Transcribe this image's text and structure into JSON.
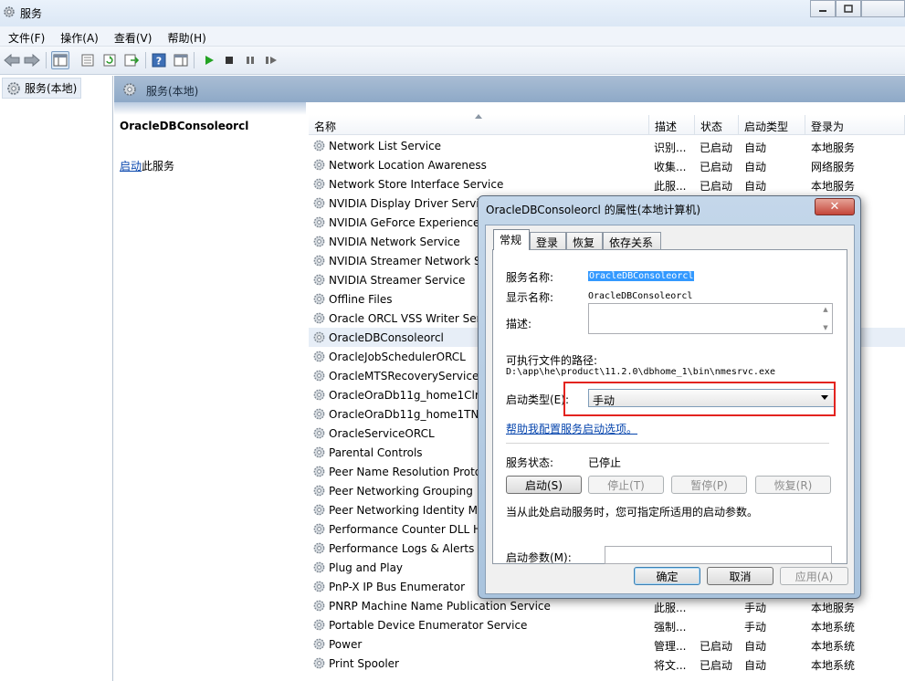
{
  "window": {
    "title": "服务"
  },
  "menu": [
    "文件(F)",
    "操作(A)",
    "查看(V)",
    "帮助(H)"
  ],
  "tree": {
    "root": "服务(本地)"
  },
  "header": {
    "title": "服务(本地)"
  },
  "extended": {
    "service_name": "OracleDBConsoleorcl",
    "action_link": "启动",
    "action_suffix": "此服务"
  },
  "columns": [
    "名称",
    "描述",
    "状态",
    "启动类型",
    "登录为"
  ],
  "services": [
    {
      "name": "Network List Service",
      "desc": "识别...",
      "status": "已启动",
      "startup": "自动",
      "logon": "本地服务"
    },
    {
      "name": "Network Location Awareness",
      "desc": "收集...",
      "status": "已启动",
      "startup": "自动",
      "logon": "网络服务"
    },
    {
      "name": "Network Store Interface Service",
      "desc": "此服...",
      "status": "已启动",
      "startup": "自动",
      "logon": "本地服务"
    },
    {
      "name": "NVIDIA Display Driver Servic",
      "desc": "",
      "status": "",
      "startup": "",
      "logon": ""
    },
    {
      "name": "NVIDIA GeForce Experience",
      "desc": "",
      "status": "",
      "startup": "",
      "logon": ""
    },
    {
      "name": "NVIDIA Network Service",
      "desc": "",
      "status": "",
      "startup": "",
      "logon": ""
    },
    {
      "name": "NVIDIA Streamer Network S",
      "desc": "",
      "status": "",
      "startup": "",
      "logon": ""
    },
    {
      "name": "NVIDIA Streamer Service",
      "desc": "",
      "status": "",
      "startup": "",
      "logon": ""
    },
    {
      "name": "Offline Files",
      "desc": "",
      "status": "",
      "startup": "",
      "logon": ""
    },
    {
      "name": "Oracle ORCL VSS Writer Ser",
      "desc": "",
      "status": "",
      "startup": "",
      "logon": ""
    },
    {
      "name": "OracleDBConsoleorcl",
      "desc": "",
      "status": "",
      "startup": "",
      "logon": ""
    },
    {
      "name": "OracleJobSchedulerORCL",
      "desc": "",
      "status": "",
      "startup": "",
      "logon": ""
    },
    {
      "name": "OracleMTSRecoveryService",
      "desc": "",
      "status": "",
      "startup": "",
      "logon": ""
    },
    {
      "name": "OracleOraDb11g_home1ClrA",
      "desc": "",
      "status": "",
      "startup": "",
      "logon": ""
    },
    {
      "name": "OracleOraDb11g_home1TNS",
      "desc": "",
      "status": "",
      "startup": "",
      "logon": ""
    },
    {
      "name": "OracleServiceORCL",
      "desc": "",
      "status": "",
      "startup": "",
      "logon": ""
    },
    {
      "name": "Parental Controls",
      "desc": "",
      "status": "",
      "startup": "",
      "logon": ""
    },
    {
      "name": "Peer Name Resolution Proto",
      "desc": "",
      "status": "",
      "startup": "",
      "logon": ""
    },
    {
      "name": "Peer Networking Grouping",
      "desc": "",
      "status": "",
      "startup": "",
      "logon": ""
    },
    {
      "name": "Peer Networking Identity Ma",
      "desc": "",
      "status": "",
      "startup": "",
      "logon": ""
    },
    {
      "name": "Performance Counter DLL H",
      "desc": "",
      "status": "",
      "startup": "",
      "logon": ""
    },
    {
      "name": "Performance Logs & Alerts",
      "desc": "",
      "status": "",
      "startup": "",
      "logon": ""
    },
    {
      "name": "Plug and Play",
      "desc": "",
      "status": "",
      "startup": "",
      "logon": ""
    },
    {
      "name": "PnP-X IP Bus Enumerator",
      "desc": "",
      "status": "",
      "startup": "",
      "logon": ""
    },
    {
      "name": "PNRP Machine Name Publication Service",
      "desc": "此服...",
      "status": "",
      "startup": "手动",
      "logon": "本地服务"
    },
    {
      "name": "Portable Device Enumerator Service",
      "desc": "强制...",
      "status": "",
      "startup": "手动",
      "logon": "本地系统"
    },
    {
      "name": "Power",
      "desc": "管理...",
      "status": "已启动",
      "startup": "自动",
      "logon": "本地系统"
    },
    {
      "name": "Print Spooler",
      "desc": "将文...",
      "status": "已启动",
      "startup": "自动",
      "logon": "本地系统"
    }
  ],
  "dialog": {
    "title": "OracleDBConsoleorcl 的属性(本地计算机)",
    "close": "✕",
    "tabs": [
      "常规",
      "登录",
      "恢复",
      "依存关系"
    ],
    "service_name_label": "服务名称:",
    "service_name": "OracleDBConsoleorcl",
    "display_name_label": "显示名称:",
    "display_name": "OracleDBConsoleorcl",
    "description_label": "描述:",
    "path_label": "可执行文件的路径:",
    "path": "D:\\app\\he\\product\\11.2.0\\dbhome_1\\bin\\nmesrvc.exe",
    "startup_type_label": "启动类型(E):",
    "startup_type": "手动",
    "help_link": "帮助我配置服务启动选项。",
    "status_label": "服务状态:",
    "status": "已停止",
    "btn_start": "启动(S)",
    "btn_stop": "停止(T)",
    "btn_pause": "暂停(P)",
    "btn_resume": "恢复(R)",
    "hint": "当从此处启动服务时，您可指定所适用的启动参数。",
    "params_label": "启动参数(M):",
    "params_value": "",
    "btn_ok": "确定",
    "btn_cancel": "取消",
    "btn_apply": "应用(A)"
  },
  "colors": {
    "selection": "#3399ff",
    "highlight_box": "#e3231f",
    "link": "#0645ad"
  }
}
